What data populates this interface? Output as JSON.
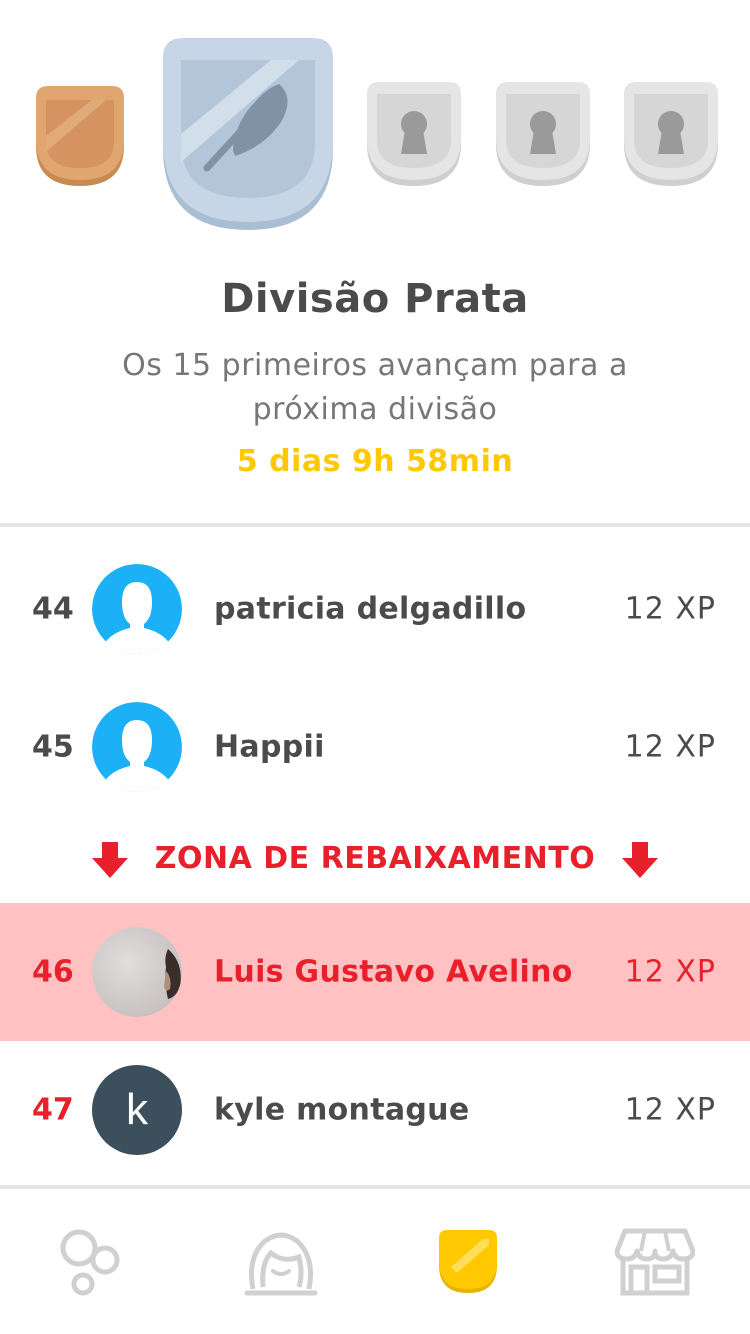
{
  "league": {
    "title": "Divisão Prata",
    "subtitle": "Os 15 primeiros avançam para a próxima divisão",
    "timer": "5 dias 9h 58min",
    "badges": [
      {
        "name": "bronze-badge",
        "state": "unlocked",
        "color": "#e1a56f"
      },
      {
        "name": "silver-badge",
        "state": "current",
        "color": "#c6d6e6"
      },
      {
        "name": "locked-badge",
        "state": "locked",
        "color": "#dddddd"
      },
      {
        "name": "locked-badge",
        "state": "locked",
        "color": "#dddddd"
      },
      {
        "name": "locked-badge",
        "state": "locked",
        "color": "#dddddd"
      }
    ]
  },
  "leaderboard": {
    "rows": [
      {
        "rank": "44",
        "name": "patricia delgadillo",
        "xp": "12 XP",
        "avatar": "default-avatar-icon"
      },
      {
        "rank": "45",
        "name": "Happii",
        "xp": "12 XP",
        "avatar": "default-avatar-icon"
      },
      {
        "rank": "46",
        "name": "Luis Gustavo Avelino",
        "xp": "12 XP",
        "avatar": "photo-avatar",
        "highlighted": true
      },
      {
        "rank": "47",
        "name": "kyle montague",
        "xp": "12 XP",
        "avatar": "letter-avatar",
        "avatar_letter": "k"
      }
    ],
    "demotion_zone_label": "ZONA DE REBAIXAMENTO"
  },
  "nav": {
    "items": [
      {
        "icon": "learn-bubbles-icon",
        "active": false
      },
      {
        "icon": "profile-icon",
        "active": false
      },
      {
        "icon": "leaderboard-shield-icon",
        "active": true
      },
      {
        "icon": "shop-icon",
        "active": false
      }
    ]
  },
  "colors": {
    "accent_yellow": "#ffc800",
    "demotion_red": "#e8202b",
    "highlight_row": "#ffc1c1",
    "avatar_blue": "#1cb0f6"
  }
}
